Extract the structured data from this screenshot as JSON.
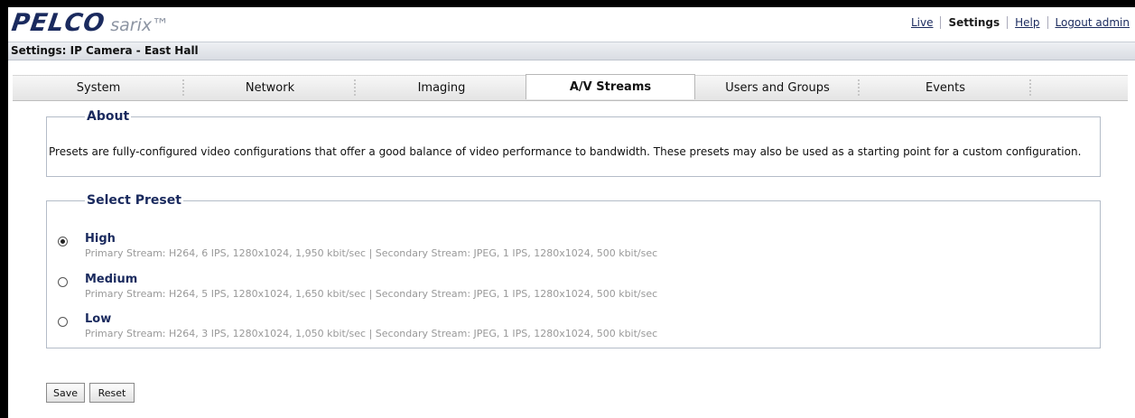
{
  "brand": {
    "logo_text": "PELCO",
    "product": "sarix™"
  },
  "toplinks": {
    "live": "Live",
    "settings": "Settings",
    "help": "Help",
    "logout": "Logout admin"
  },
  "page_title": "Settings: IP Camera - East Hall",
  "tabs": [
    {
      "label": "System"
    },
    {
      "label": "Network"
    },
    {
      "label": "Imaging"
    },
    {
      "label": "A/V Streams",
      "active": true
    },
    {
      "label": "Users and Groups"
    },
    {
      "label": "Events"
    }
  ],
  "about": {
    "legend": "About",
    "text": "Presets are fully-configured video configurations that offer a good balance of video performance to bandwidth. These presets may also be used as a starting point for a custom configuration."
  },
  "select_preset": {
    "legend": "Select Preset",
    "options": [
      {
        "name": "High",
        "checked": true,
        "desc": "Primary Stream: H264, 6 IPS, 1280x1024, 1,950 kbit/sec | Secondary Stream: JPEG, 1 IPS, 1280x1024, 500 kbit/sec"
      },
      {
        "name": "Medium",
        "checked": false,
        "desc": "Primary Stream: H264, 5 IPS, 1280x1024, 1,650 kbit/sec | Secondary Stream: JPEG, 1 IPS, 1280x1024, 500 kbit/sec"
      },
      {
        "name": "Low",
        "checked": false,
        "desc": "Primary Stream: H264, 3 IPS, 1280x1024, 1,050 kbit/sec | Secondary Stream: JPEG, 1 IPS, 1280x1024, 500 kbit/sec"
      }
    ]
  },
  "buttons": {
    "save": "Save",
    "reset": "Reset"
  }
}
